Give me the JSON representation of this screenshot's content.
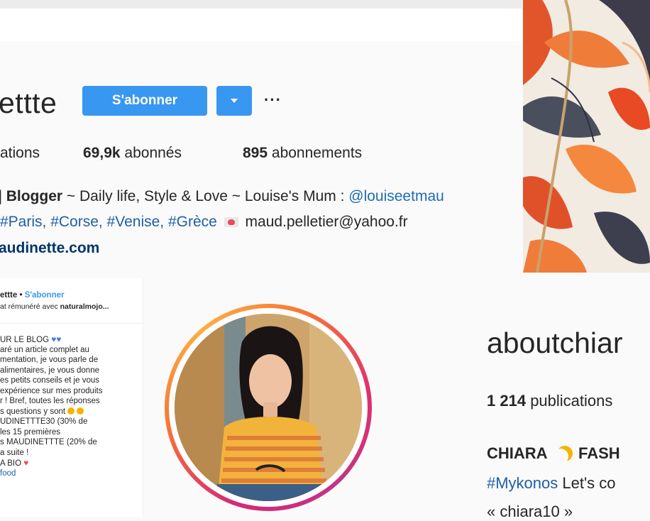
{
  "profile1": {
    "username": "ettte",
    "follow_button": "S'abonner",
    "more": "···",
    "stats": {
      "publications_partial": "ations",
      "followers_value": "69,9k",
      "followers_label": "abonnés",
      "following_value": "895",
      "following_label": "abonnements"
    },
    "bio": {
      "role": "| Blogger",
      "tagline": "~ Daily life, Style & Love ~ Louise's Mum : ",
      "mention": "@louiseetmau",
      "tags": "#Paris, #Corse, #Venise, #Grèce",
      "email": "maud.pelletier@yahoo.fr",
      "website": "audinette.com"
    }
  },
  "post": {
    "header_user": "ettte",
    "header_sep": " • ",
    "header_follow": "S'abonner",
    "header_sub_pre": "at rémunéré avec ",
    "header_sub_bold": "naturalmojo...",
    "lines": [
      "UR LE BLOG",
      "aré un article complet au",
      "mentation, je vous parle de",
      "alimentaires, je vous donne",
      "es petits conseils et je vous",
      "expérience sur mes produits",
      "r ! Bref, toutes les réponses",
      "s questions y sont",
      "UDINETTTE30 (30% de",
      "les 15 premières",
      "s MAUDINETTTE (20% de",
      "a suite !",
      "A BIO",
      "food"
    ]
  },
  "profile2": {
    "username": "aboutchiar",
    "publications_value": "1 214",
    "publications_label": "publications",
    "name": "CHIARA",
    "name_rest": "FASH",
    "bio_tag": "#Mykonos",
    "bio_rest": " Let's co",
    "bio_line3": "« chiara10 »"
  },
  "colors": {
    "accent": "#3897f0",
    "link": "#003569",
    "text": "#262626",
    "background": "#fafafa"
  },
  "icons": {
    "dropdown": "chevron-down-icon",
    "more": "more-options-icon",
    "hearts": "blue-heart-icon"
  }
}
